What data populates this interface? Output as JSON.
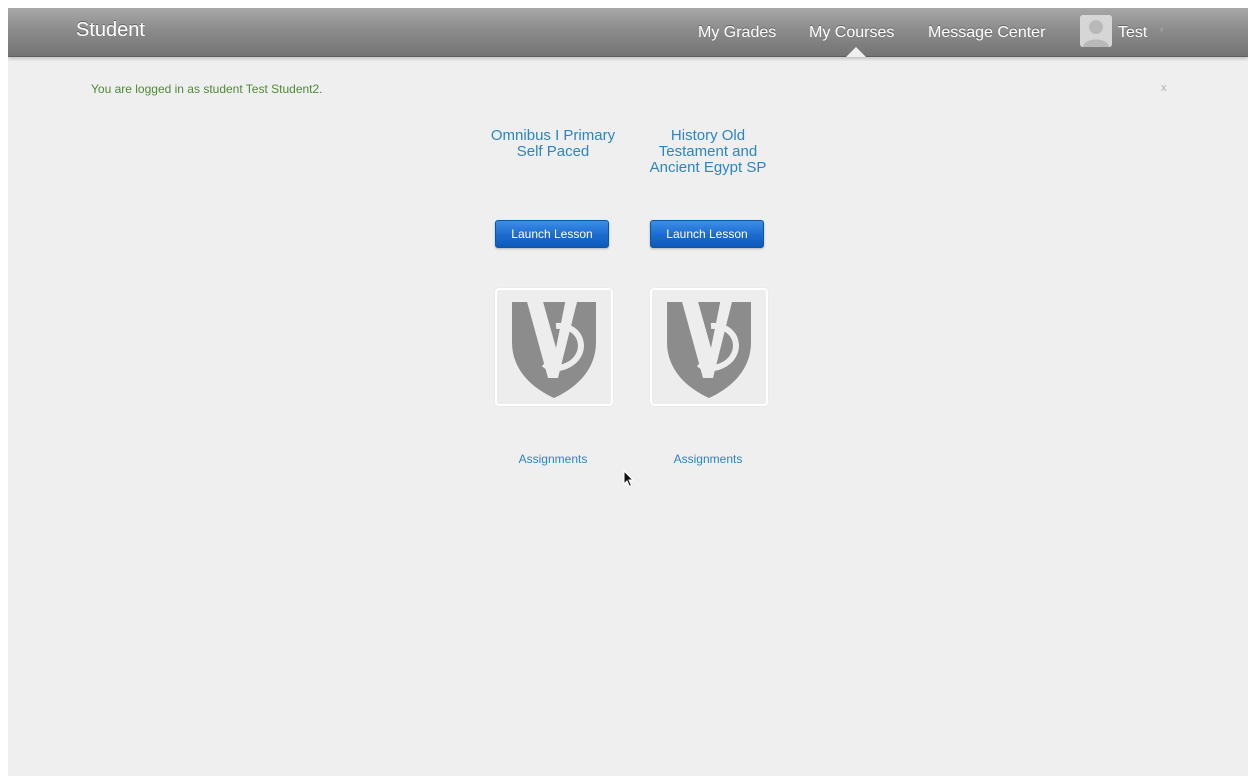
{
  "header": {
    "brand": "Student",
    "nav": [
      {
        "label": "My Grades"
      },
      {
        "label": "My Courses"
      },
      {
        "label": "Message Center"
      }
    ],
    "active_nav": "My Courses",
    "user": {
      "name": "Test"
    }
  },
  "notice": {
    "text": "You are logged in as student Test Student2.",
    "close_label": "x"
  },
  "courses": [
    {
      "title": "Omnibus I Primary Self Paced",
      "launch_label": "Launch Lesson",
      "assignments_label": "Assignments"
    },
    {
      "title": "History Old Testament and Ancient Egypt SP",
      "launch_label": "Launch Lesson",
      "assignments_label": "Assignments"
    }
  ],
  "colors": {
    "link": "#2b86c1",
    "notice": "#4e8a35",
    "button": "#1a6bd0",
    "topbar": "#8c8c8c"
  }
}
